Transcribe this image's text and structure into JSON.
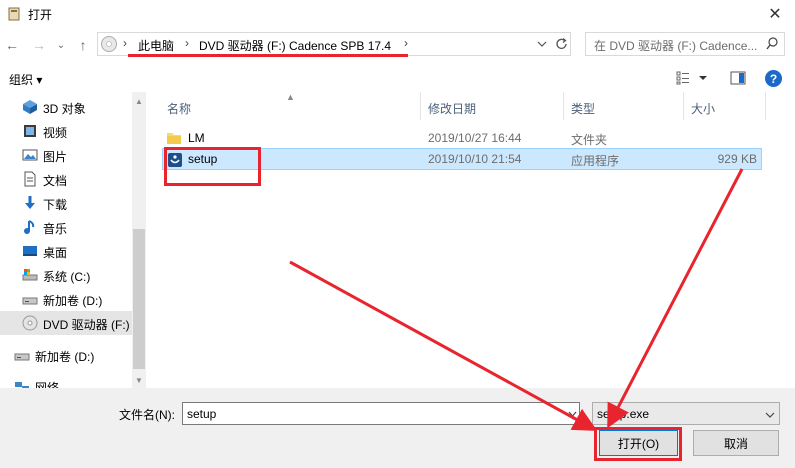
{
  "window": {
    "title": "打开",
    "close_glyph": "✕"
  },
  "nav": {
    "back_glyph": "←",
    "forward_glyph": "→",
    "recent_glyph": "⌄",
    "up_glyph": "↑",
    "breadcrumb": [
      "此电脑",
      "DVD 驱动器 (F:) Cadence SPB 17.4"
    ],
    "separator": "›",
    "search_placeholder": "在 DVD 驱动器 (F:) Cadence..."
  },
  "toolbar": {
    "organize_label": "组织 ▾",
    "help_glyph": "?"
  },
  "sidebar": {
    "items": [
      {
        "label": "3D 对象",
        "icon": "3d-objects-icon"
      },
      {
        "label": "视频",
        "icon": "videos-icon"
      },
      {
        "label": "图片",
        "icon": "pictures-icon"
      },
      {
        "label": "文档",
        "icon": "documents-icon"
      },
      {
        "label": "下载",
        "icon": "downloads-icon"
      },
      {
        "label": "音乐",
        "icon": "music-icon"
      },
      {
        "label": "桌面",
        "icon": "desktop-icon"
      },
      {
        "label": "系统 (C:)",
        "icon": "system-drive-icon"
      },
      {
        "label": "新加卷 (D:)",
        "icon": "drive-icon"
      },
      {
        "label": "DVD 驱动器 (F:)",
        "icon": "dvd-drive-icon"
      },
      {
        "label": "新加卷 (D:)",
        "icon": "drive-icon"
      },
      {
        "label": "网络",
        "icon": "network-icon"
      }
    ]
  },
  "columns": [
    "名称",
    "修改日期",
    "类型",
    "大小"
  ],
  "files": [
    {
      "name": "LM",
      "modified": "2019/10/27 16:44",
      "type": "文件夹",
      "size": "",
      "icon": "folder-icon"
    },
    {
      "name": "setup",
      "modified": "2019/10/10 21:54",
      "type": "应用程序",
      "size": "929 KB",
      "icon": "setup-app-icon"
    }
  ],
  "footer": {
    "filename_label": "文件名(N):",
    "filename_value": "setup",
    "filetype_value": "setup.exe",
    "open_label": "打开(O)",
    "cancel_label": "取消"
  },
  "colors": {
    "annotation": "#e8242f",
    "selection": "#cce8ff",
    "accent": "#0078d7"
  }
}
